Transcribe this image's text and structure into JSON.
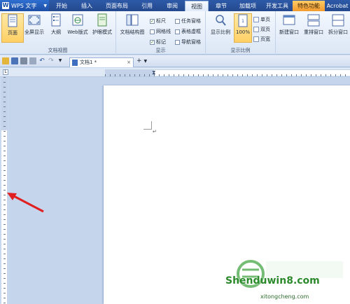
{
  "app": {
    "title": "WPS 文字"
  },
  "tabs": [
    {
      "label": "开始"
    },
    {
      "label": "插入"
    },
    {
      "label": "页面布局"
    },
    {
      "label": "引用"
    },
    {
      "label": "审阅"
    },
    {
      "label": "视图"
    },
    {
      "label": "章节"
    },
    {
      "label": "加载项"
    },
    {
      "label": "开发工具"
    },
    {
      "label": "特色功能"
    },
    {
      "label": "Acrobat"
    }
  ],
  "ribbon": {
    "doc_view": {
      "group_name": "文档视图",
      "buttons": [
        {
          "label": "页面"
        },
        {
          "label": "全屏显示"
        },
        {
          "label": "大纲"
        },
        {
          "label": "Web版式"
        },
        {
          "label": "护眼模式"
        }
      ]
    },
    "show": {
      "group_name": "显示",
      "structure_button": "文档结构图",
      "checks": [
        {
          "label": "标尺",
          "checked": true
        },
        {
          "label": "网格线",
          "checked": false
        },
        {
          "label": "标记",
          "checked": true
        },
        {
          "label": "任务窗格",
          "checked": false
        },
        {
          "label": "表格虚框",
          "checked": false
        },
        {
          "label": "导航窗格",
          "checked": false
        }
      ]
    },
    "zoom": {
      "group_name": "显示比例",
      "zoom_button": "显示比例",
      "percent_button": "100%",
      "single_page": "单页",
      "double_page": "双页",
      "page_width": "页宽"
    },
    "window": {
      "new_window": "新建窗口",
      "rearrange": "重排窗口",
      "split": "拆分窗口"
    }
  },
  "document_tab": {
    "label": "文档1 *"
  },
  "document": {
    "paragraph_mark": "↵"
  },
  "watermark": {
    "text": "Shenduwin8.com",
    "sub": "xitongcheng.com"
  },
  "colors": {
    "accent": "#2d5aa8",
    "special_tab": "#f29a2e",
    "arrow": "#e02020"
  }
}
